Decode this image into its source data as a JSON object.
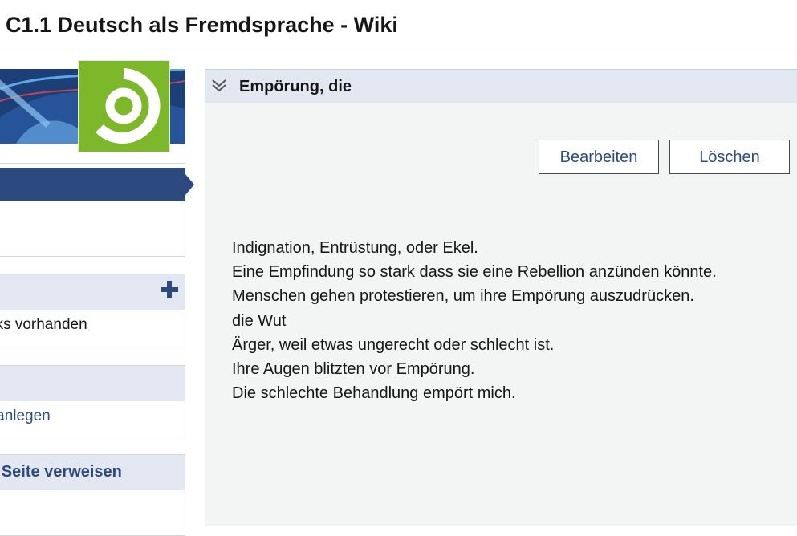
{
  "header": {
    "title": "C1.1 Deutsch als Fremdsprache - Wiki"
  },
  "sidebar": {
    "panel_links": {
      "body": "nks vorhanden"
    },
    "panel_create": {
      "body": "te anlegen"
    },
    "panel_refer": {
      "title": "se Seite verweisen"
    }
  },
  "page": {
    "title": "Empörung, die",
    "buttons": {
      "edit": "Bearbeiten",
      "delete": "Löschen"
    },
    "lines": [
      "Indignation, Entrüstung, oder Ekel.",
      "Eine Empfindung so stark dass sie eine Rebellion anzünden könnte.",
      "Menschen gehen protestieren, um ihre Empörung auszudrücken.",
      "die Wut",
      "Ärger, weil etwas ungerecht oder schlecht ist.",
      "Ihre Augen blitzten vor Empörung.",
      "Die schlechte Behandlung empört mich."
    ]
  },
  "colors": {
    "accent": "#2c4a7e",
    "panel_header": "#e2e7f1",
    "logo_green": "#7cb82a"
  }
}
